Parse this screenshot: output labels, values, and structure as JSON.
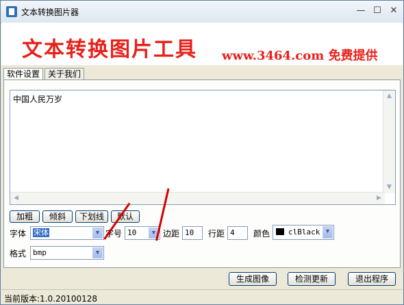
{
  "window": {
    "title": "文本转换图片器",
    "minimize": "—",
    "maximize": "☐",
    "close": "✕"
  },
  "banner": {
    "title": "文本转换图片工具",
    "subtitle": "www.3464.com 免费提供"
  },
  "tabs": [
    {
      "label": "软件设置",
      "active": true
    },
    {
      "label": "关于我们",
      "active": false
    }
  ],
  "editor": {
    "content": "中国人民万岁"
  },
  "style_buttons": {
    "bold": "加粗",
    "italic": "倾斜",
    "underline": "下划线",
    "default": "默认"
  },
  "settings": {
    "font_label": "字体",
    "font_value": "宋体",
    "size_label": "字号",
    "size_value": "10",
    "margin_label": "边距",
    "margin_value": "10",
    "linespacing_label": "行距",
    "linespacing_value": "4",
    "color_label": "颜色",
    "color_value": "clBlack",
    "format_label": "格式",
    "format_value": "bmp"
  },
  "actions": {
    "generate": "生成图像",
    "check_update": "检测更新",
    "exit": "退出程序"
  },
  "status": {
    "version": "当前版本:1.0.20100128"
  },
  "icons": {
    "app": "app-edit-icon",
    "dropdown": "chevron-down-icon"
  },
  "colors": {
    "banner_red": "#e8201a",
    "selection_blue": "#316ac5",
    "window_bg": "#ece9d8"
  }
}
